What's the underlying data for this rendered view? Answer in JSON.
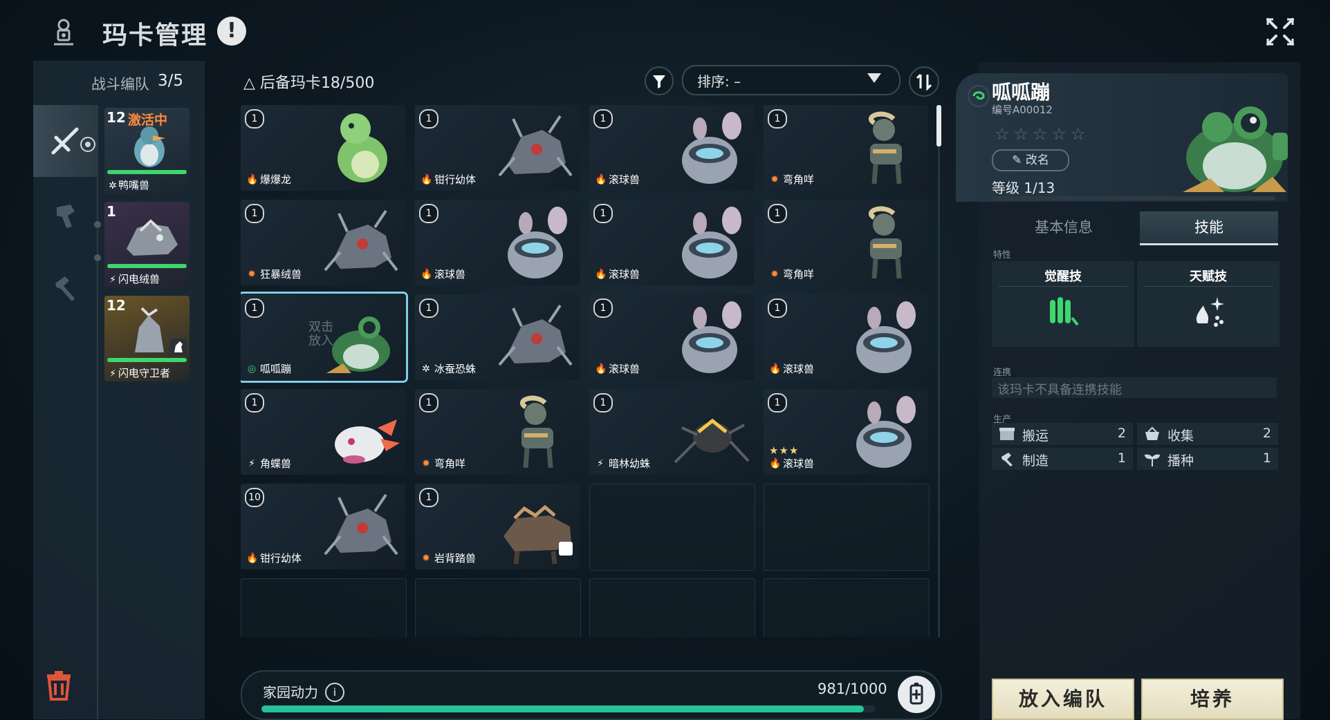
{
  "header": {
    "title": "玛卡管理",
    "alert_glyph": "!"
  },
  "team": {
    "label": "战斗编队",
    "count": "3/5",
    "members": [
      {
        "level": "12",
        "status": "激活中",
        "name": "鸭嘴兽",
        "element": "ice",
        "hp": 1.0
      },
      {
        "level": "1",
        "status": "",
        "name": "闪电绒兽",
        "element": "electric",
        "hp": 1.0
      },
      {
        "level": "12",
        "status": "",
        "name": "闪电守卫者",
        "element": "electric",
        "hp": 1.0
      }
    ]
  },
  "reserve": {
    "label": "后备玛卡",
    "count": "18/500",
    "sort_label": "排序: –",
    "cards": [
      {
        "level": "1",
        "name": "爆爆龙",
        "element": "fire",
        "creature": "dino"
      },
      {
        "level": "1",
        "name": "钳行幼体",
        "element": "fire",
        "creature": "mech-spider"
      },
      {
        "level": "1",
        "name": "滚球兽",
        "element": "fire",
        "creature": "mouse"
      },
      {
        "level": "1",
        "name": "弯角咩",
        "element": "gear",
        "creature": "ram"
      },
      {
        "level": "1",
        "name": "狂暴绒兽",
        "element": "gear",
        "creature": "mech-spider"
      },
      {
        "level": "1",
        "name": "滚球兽",
        "element": "fire",
        "creature": "mouse"
      },
      {
        "level": "1",
        "name": "滚球兽",
        "element": "fire",
        "creature": "mouse"
      },
      {
        "level": "1",
        "name": "弯角咩",
        "element": "gear",
        "creature": "ram"
      },
      {
        "level": "1",
        "name": "呱呱蹦",
        "element": "wind",
        "creature": "frog",
        "selected": true,
        "hint": "双击放入"
      },
      {
        "level": "1",
        "name": "冰蚕恐蛛",
        "element": "ice",
        "creature": "mech-spider"
      },
      {
        "level": "1",
        "name": "滚球兽",
        "element": "fire",
        "creature": "mouse"
      },
      {
        "level": "1",
        "name": "滚球兽",
        "element": "fire",
        "creature": "mouse"
      },
      {
        "level": "1",
        "name": "角蝶兽",
        "element": "electric",
        "creature": "axolotl"
      },
      {
        "level": "1",
        "name": "弯角咩",
        "element": "gear",
        "creature": "ram"
      },
      {
        "level": "1",
        "name": "暗林幼蛛",
        "element": "electric",
        "creature": "spider"
      },
      {
        "level": "1",
        "name": "滚球兽",
        "element": "fire",
        "creature": "mouse",
        "stars": "★★★"
      },
      {
        "level": "10",
        "name": "钳行幼体",
        "element": "fire",
        "creature": "mech-spider"
      },
      {
        "level": "1",
        "name": "岩背踏兽",
        "element": "gear",
        "creature": "beast"
      }
    ]
  },
  "home_power": {
    "label": "家园动力",
    "value": "981/1000",
    "ratio": 0.981
  },
  "detail": {
    "name": "呱呱蹦",
    "code": "编号A00012",
    "stars": "☆☆☆☆☆",
    "rename": "改名",
    "level": "等级 1/13",
    "level_ratio": 0.077,
    "tabs": [
      "基本信息",
      "技能"
    ],
    "trait_label": "特性",
    "awaken_skill": "觉醒技",
    "talent_skill": "天赋技",
    "link_label": "连携",
    "link_text": "该玛卡不具备连携技能",
    "prod_label": "生产",
    "production": [
      {
        "name": "搬运",
        "value": "2",
        "icon": "box-icon"
      },
      {
        "name": "收集",
        "value": "2",
        "icon": "basket-icon"
      },
      {
        "name": "制造",
        "value": "1",
        "icon": "hammer-icon"
      },
      {
        "name": "播种",
        "value": "1",
        "icon": "sprout-icon"
      }
    ]
  },
  "actions": {
    "add_to_team": "放入编队",
    "train": "培养"
  },
  "colors": {
    "accent": "#28c29a",
    "fire": "#ff6a3a",
    "gear": "#ff8a3a",
    "electric": "#ffffff",
    "ice": "#ffffff",
    "wind": "#3ed66d",
    "selected": "#7fd0e8",
    "active_status": "#ff8a3a"
  }
}
